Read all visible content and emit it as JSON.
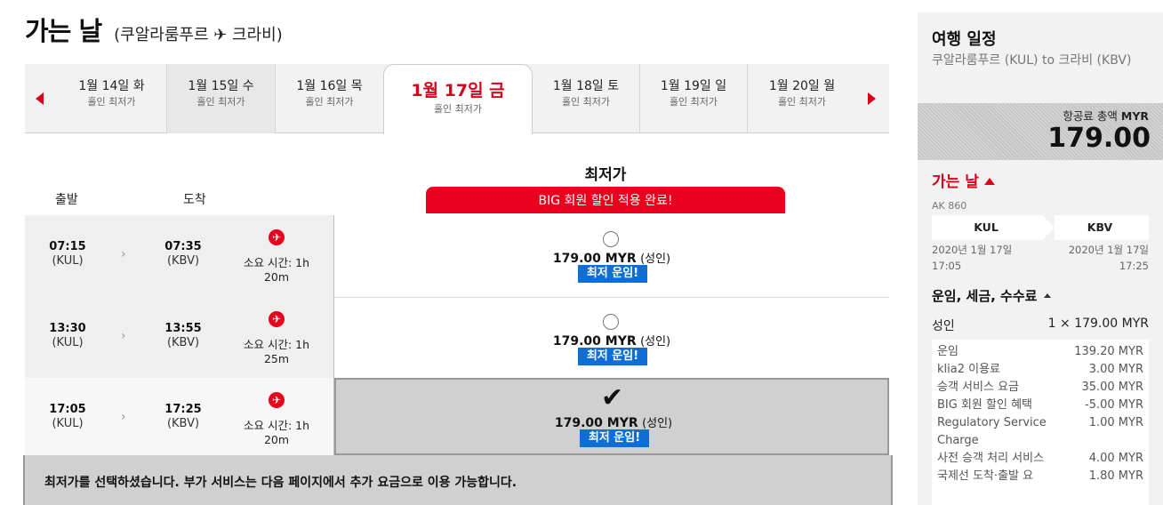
{
  "header": {
    "title": "가는 날",
    "route": "(쿠알라룸푸르 ✈ 크라비)"
  },
  "date_strip": {
    "tabs": [
      {
        "date": "1월 14일 화",
        "sub": "홀인 최저가"
      },
      {
        "date": "1월 15일 수",
        "sub": "홀인 최저가"
      },
      {
        "date": "1월 16일 목",
        "sub": "홀인 최저가"
      },
      {
        "date": "1월 17일 금",
        "sub": "홀인 최저가"
      },
      {
        "date": "1월 18일 토",
        "sub": "홀인 최저가"
      },
      {
        "date": "1월 19일 일",
        "sub": "홀인 최저가"
      },
      {
        "date": "1월 20일 월",
        "sub": "홀인 최저가"
      }
    ],
    "selected_index": 3
  },
  "columns": {
    "depart": "출발",
    "arrive": "도착",
    "lowest": "최저가",
    "big_banner": "BIG 회원 할인 적용 완료!"
  },
  "flights": [
    {
      "dep_time": "07:15",
      "dep_code": "(KUL)",
      "arr_time": "07:35",
      "arr_code": "(KBV)",
      "duration_1": "소요 시간: 1h",
      "duration_2": "20m",
      "price": "179.00 MYR",
      "pax": "(성인)",
      "badge": "최저 운임!",
      "selected": false
    },
    {
      "dep_time": "13:30",
      "dep_code": "(KUL)",
      "arr_time": "13:55",
      "arr_code": "(KBV)",
      "duration_1": "소요 시간: 1h",
      "duration_2": "25m",
      "price": "179.00 MYR",
      "pax": "(성인)",
      "badge": "최저 운임!",
      "selected": false
    },
    {
      "dep_time": "17:05",
      "dep_code": "(KUL)",
      "arr_time": "17:25",
      "arr_code": "(KBV)",
      "duration_1": "소요 시간: 1h",
      "duration_2": "20m",
      "price": "179.00 MYR",
      "pax": "(성인)",
      "badge": "최저 운임!",
      "selected": true
    }
  ],
  "notice": "최저가를 선택하셨습니다. 부가 서비스는 다음 페이지에서 추가 요금으로 이용 가능합니다.",
  "sidebar": {
    "title": "여행 일정",
    "route": "쿠알라룸푸르 (KUL) to 크라비 (KBV)",
    "total_label": "항공료 총액",
    "total_currency": "MYR",
    "total_amount": "179.00",
    "going_label": "가는 날",
    "flight_no": "AK 860",
    "origin": "KUL",
    "destination": "KBV",
    "dep_date": "2020년 1월 17일",
    "dep_time": "17:05",
    "arr_date": "2020년 1월 17일",
    "arr_time": "17:25",
    "fares_title": "운임, 세금, 수수료",
    "adult_label": "성인",
    "adult_value": "1 × 179.00 MYR",
    "breakdown": [
      {
        "label": "운임",
        "value": "139.20 MYR"
      },
      {
        "label": "klia2 이용료",
        "value": "3.00 MYR"
      },
      {
        "label": "승객 서비스 요금",
        "value": "35.00 MYR"
      },
      {
        "label": "BIG 회원 할인 혜택",
        "value": "-5.00 MYR"
      },
      {
        "label": "Regulatory Service Charge",
        "value": "1.00 MYR"
      },
      {
        "label": "사전 승객 처리 서비스",
        "value": "4.00 MYR"
      },
      {
        "label": "국제선 도착·출발 요",
        "value": "1.80 MYR"
      }
    ]
  },
  "colors": {
    "brand_red": "#e8001c",
    "badge_blue": "#0d6fd6"
  },
  "icons": {
    "plane": "airplane-circle-icon",
    "prev": "triangle-left-icon",
    "next": "triangle-right-icon",
    "check": "checkmark-icon"
  }
}
